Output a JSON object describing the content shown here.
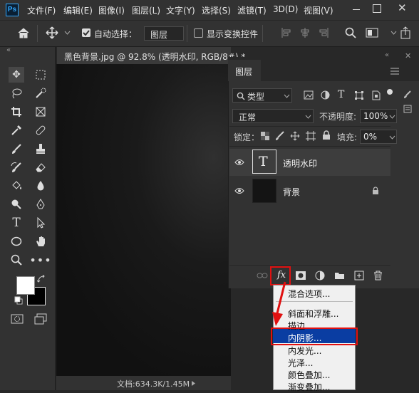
{
  "app": {
    "logo": "Ps"
  },
  "menubar": {
    "items": [
      "文件(F)",
      "编辑(E)",
      "图像(I)",
      "图层(L)",
      "文字(Y)",
      "选择(S)",
      "滤镜(T)",
      "3D(D)",
      "视图(V)"
    ]
  },
  "window_controls": {
    "close": "✕"
  },
  "options": {
    "auto_select_label": "自动选择：",
    "auto_select_value": "图层",
    "show_transform_label": "显示变换控件"
  },
  "document": {
    "tab_label": "黑色背景.jpg @ 92.8% (透明水印, RGB/8#) *",
    "status": "文档:634.3K/1.45M"
  },
  "layers_panel": {
    "tab_label": "图层",
    "filter_label": "类型",
    "blend_mode": "正常",
    "opacity_label": "不透明度:",
    "opacity_value": "100%",
    "lock_label": "锁定：",
    "fill_label": "填充:",
    "fill_value": "0%",
    "layers": [
      {
        "name": "透明水印",
        "thumb": "T"
      },
      {
        "name": "背景"
      }
    ],
    "fx_label": "fx"
  },
  "fx_menu": {
    "items": [
      "混合选项...",
      "斜面和浮雕...",
      "描边...",
      "内阴影...",
      "内发光...",
      "光泽...",
      "颜色叠加...",
      "渐变叠加..."
    ],
    "highlighted_index": 3
  },
  "colors": {
    "accent": "#0a3da2",
    "annotation": "#e01010",
    "foreground": "#ffffff",
    "background": "#000000"
  }
}
